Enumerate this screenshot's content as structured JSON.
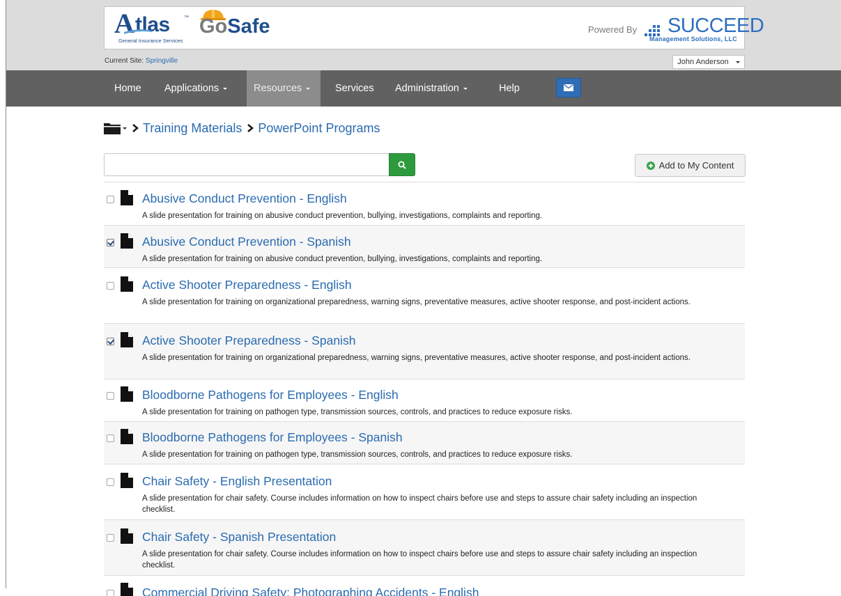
{
  "header": {
    "brand_atlas": "tlas",
    "brand_atlas_initial": "A",
    "brand_atlas_tm": "™",
    "brand_atlas_sub": "General Insurance Services",
    "brand_go": "Go",
    "brand_safe": "Safe",
    "powered_by": "Powered By",
    "succeed": "SUCCEED",
    "succeed_sub": "Management Solutions, LLC",
    "current_site_label": "Current Site:",
    "current_site_value": "Springville",
    "user_name": "John Anderson"
  },
  "nav": {
    "items": [
      {
        "label": "Home"
      },
      {
        "label": "Applications"
      },
      {
        "label": "Resources"
      },
      {
        "label": "Services"
      },
      {
        "label": "Administration"
      },
      {
        "label": "Help"
      }
    ],
    "active": "Resources"
  },
  "breadcrumb": {
    "items": [
      "Training Materials",
      "PowerPoint Programs"
    ]
  },
  "search": {
    "value": "",
    "placeholder": ""
  },
  "actions": {
    "add_label": "Add to My Content"
  },
  "items": [
    {
      "title": "Abusive Conduct Prevention - English",
      "desc": "A slide presentation for training on abusive conduct prevention, bullying, investigations, complaints and reporting.",
      "checked": false
    },
    {
      "title": "Abusive Conduct Prevention - Spanish",
      "desc": "A slide presentation for training on abusive conduct prevention, bullying, investigations, complaints and reporting.",
      "checked": true
    },
    {
      "title": "Active Shooter Preparedness - English",
      "desc": "A slide presentation for training on organizational preparedness, warning signs, preventative measures, active shooter response, and post-incident actions.",
      "checked": false
    },
    {
      "title": "Active Shooter Preparedness - Spanish",
      "desc": "A slide presentation for training on organizational preparedness, warning signs, preventative measures, active shooter response, and post-incident actions.",
      "checked": true
    },
    {
      "title": "Bloodborne Pathogens for Employees - English",
      "desc": "A slide presentation for training on pathogen type, transmission sources, controls, and practices to reduce exposure risks.",
      "checked": false
    },
    {
      "title": "Bloodborne Pathogens for Employees - Spanish",
      "desc": "A slide presentation for training on pathogen type, transmission sources, controls, and practices to reduce exposure risks.",
      "checked": false
    },
    {
      "title": "Chair Safety - English Presentation",
      "desc": "A slide presentation for chair safety. Course includes information on how to inspect chairs before use and steps to assure chair safety including an inspection checklist.",
      "checked": false
    },
    {
      "title": "Chair Safety - Spanish Presentation",
      "desc": "A slide presentation for chair safety. Course includes information on how to inspect chairs before use and steps to assure chair safety including an inspection checklist.",
      "checked": false
    },
    {
      "title": "Commercial Driving Safety: Photographing Accidents - English",
      "desc": "",
      "checked": false
    }
  ],
  "colors": {
    "nav_bg": "#616161",
    "nav_active": "#8c8c8c",
    "link": "#2a6bb0",
    "search_button": "#2e9a3e",
    "mail_button": "#2f6db5"
  }
}
